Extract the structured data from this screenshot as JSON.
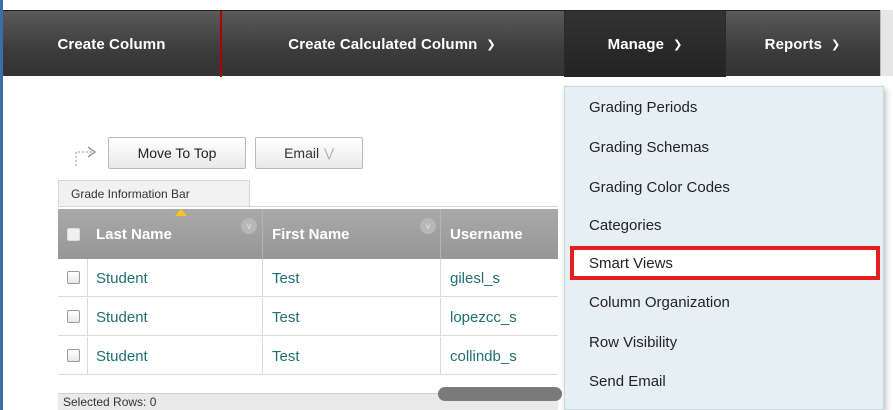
{
  "action_bar": {
    "tabs": [
      {
        "label": "Create Column",
        "has_dropdown": false
      },
      {
        "label": "Create Calculated Column",
        "has_dropdown": true
      },
      {
        "label": "Manage",
        "has_dropdown": true,
        "active": true
      },
      {
        "label": "Reports",
        "has_dropdown": true
      }
    ]
  },
  "toolbar": {
    "move_to_top_label": "Move To Top",
    "email_label": "Email"
  },
  "grade_info_bar": "Grade Information Bar",
  "grid": {
    "columns": [
      "Last Name",
      "First Name",
      "Username"
    ],
    "rows": [
      {
        "last_name": "Student",
        "first_name": "Test",
        "username": "gilesl_s"
      },
      {
        "last_name": "Student",
        "first_name": "Test",
        "username": "lopezcc_s"
      },
      {
        "last_name": "Student",
        "first_name": "Test",
        "username": "collindb_s"
      }
    ],
    "selected_rows_label": "Selected Rows: 0"
  },
  "manage_menu": {
    "items": [
      "Grading Periods",
      "Grading Schemas",
      "Grading Color Codes",
      "Categories",
      "Smart Views",
      "Column Organization",
      "Row Visibility",
      "Send Email"
    ],
    "highlighted_item": "Smart Views"
  },
  "colors": {
    "action_bar": "#3c3c3c",
    "highlight_border": "#e51f1f",
    "link_text": "#1f6f73",
    "menu_background": "#e6f0f4",
    "sort_indicator": "#ffc41a"
  }
}
